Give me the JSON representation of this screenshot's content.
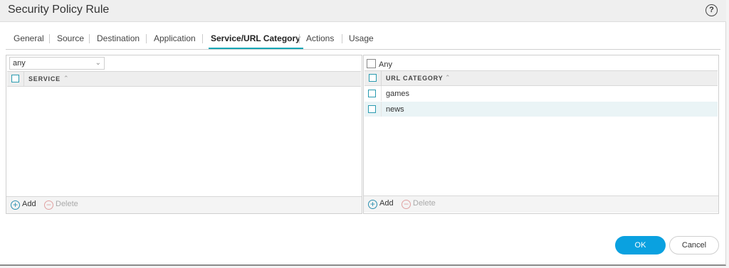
{
  "dialog": {
    "title": "Security Policy Rule",
    "help_icon": "question-circle-icon",
    "help_glyph": "?"
  },
  "tabs": [
    {
      "label": "General",
      "active": false
    },
    {
      "label": "Source",
      "active": false
    },
    {
      "label": "Destination",
      "active": false
    },
    {
      "label": "Application",
      "active": false
    },
    {
      "label": "Service/URL Category",
      "active": true
    },
    {
      "label": "Actions",
      "active": false
    },
    {
      "label": "Usage",
      "active": false
    }
  ],
  "service_panel": {
    "select_value": "any",
    "column_header": "SERVICE",
    "rows": [],
    "add_label": "Add",
    "delete_label": "Delete"
  },
  "url_panel": {
    "any_label": "Any",
    "any_checked": false,
    "column_header": "URL CATEGORY",
    "rows": [
      {
        "label": "games",
        "checked": false
      },
      {
        "label": "news",
        "checked": false
      }
    ],
    "add_label": "Add",
    "delete_label": "Delete"
  },
  "buttons": {
    "ok_label": "OK",
    "cancel_label": "Cancel"
  },
  "colors": {
    "accent": "#14a6b5",
    "ok_button": "#0aa1e0",
    "checkbox_border": "#2a9bb0"
  }
}
